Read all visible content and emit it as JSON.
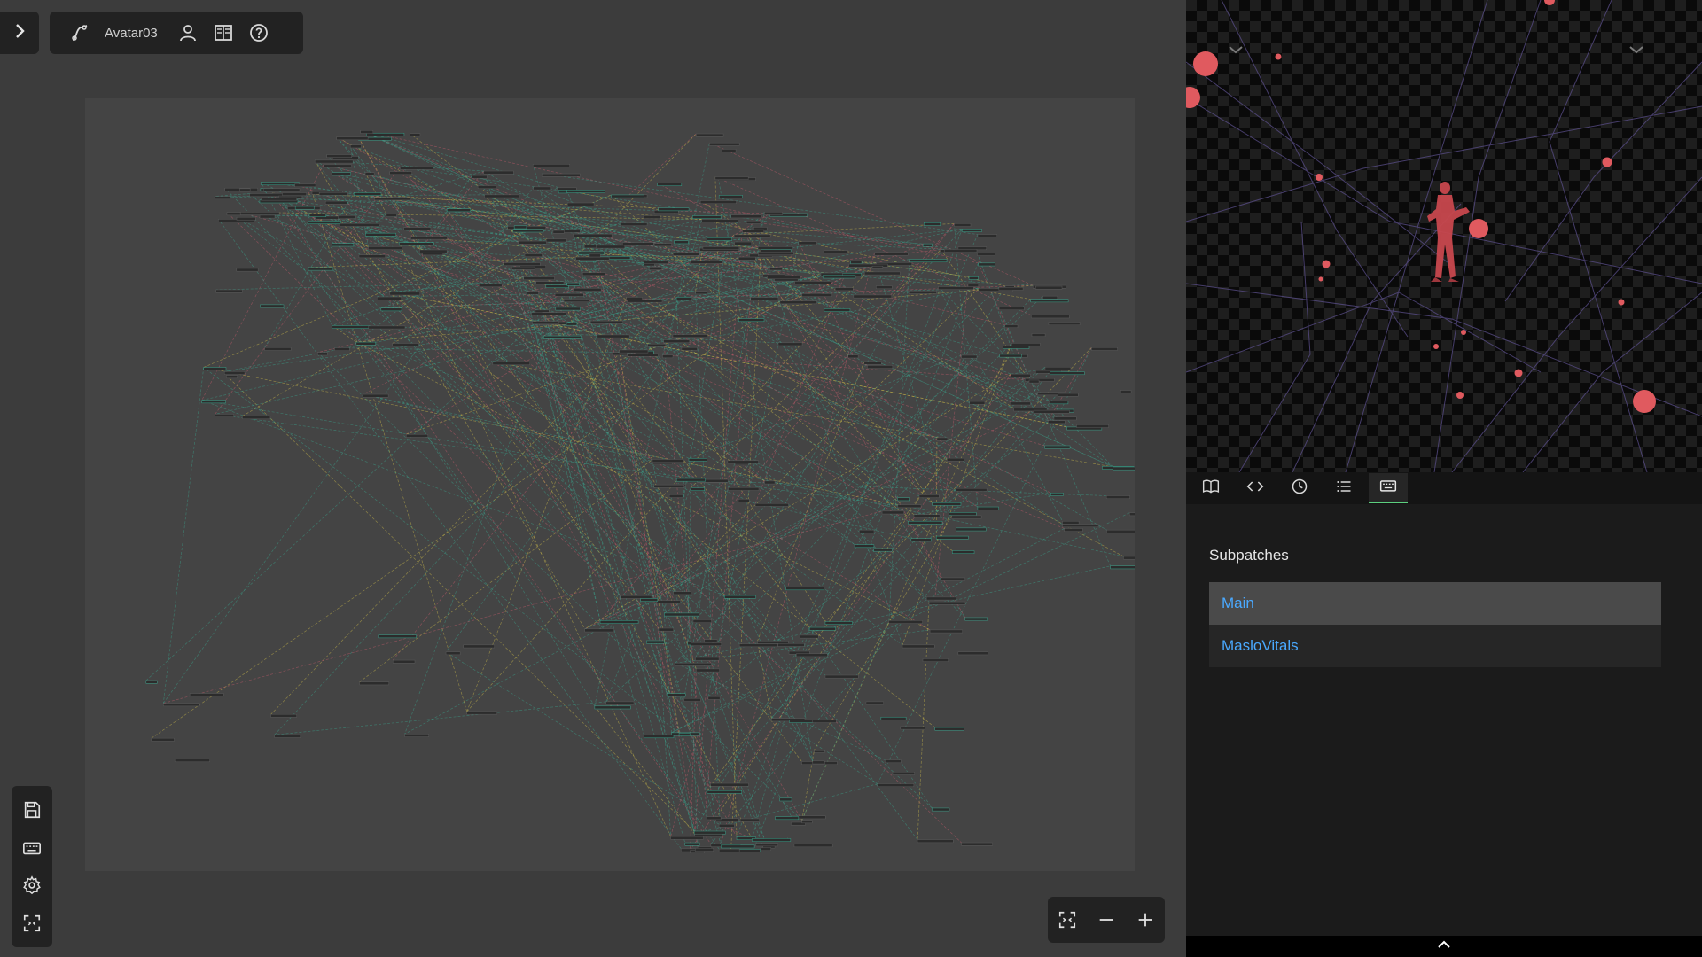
{
  "toolbar": {
    "patch_name": "Avatar03",
    "icons": [
      "chevron-right-icon",
      "patch-curve-icon",
      "user-icon",
      "book-columns-icon",
      "help-circle-icon"
    ]
  },
  "left_tools": [
    "save-icon",
    "keyboard-icon",
    "gear-icon",
    "focus-frame-icon"
  ],
  "zoom_controls": [
    "fit-to-screen-icon",
    "zoom-out-icon",
    "zoom-in-icon"
  ],
  "panel_tabs": [
    {
      "name": "docs",
      "icon": "book-open-icon",
      "active": false
    },
    {
      "name": "code",
      "icon": "code-icon",
      "active": false
    },
    {
      "name": "history",
      "icon": "clock-icon",
      "active": false
    },
    {
      "name": "list",
      "icon": "list-icon",
      "active": false
    },
    {
      "name": "subpatches",
      "icon": "keyboard-icon",
      "active": true
    }
  ],
  "subpatches": {
    "title": "Subpatches",
    "items": [
      {
        "label": "Main",
        "selected": true
      },
      {
        "label": "MasloVitals",
        "selected": false
      }
    ]
  },
  "colors": {
    "accent_green": "#5cd07f",
    "link_blue": "#4aa9ff",
    "sphere_red": "#e05a5f",
    "cable_green": "#3aa08a",
    "cable_red": "#c05a6a",
    "cable_yellow": "#c9b84a"
  }
}
